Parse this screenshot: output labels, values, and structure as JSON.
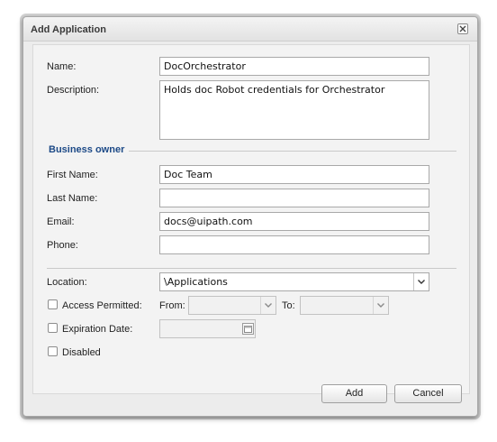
{
  "dialog": {
    "title": "Add Application",
    "close_icon": "close-icon"
  },
  "form": {
    "name": {
      "label": "Name:",
      "value": "DocOrchestrator"
    },
    "description": {
      "label": "Description:",
      "value": "Holds doc Robot credentials for Orchestrator"
    },
    "business_owner": {
      "section_title": "Business owner",
      "first_name": {
        "label": "First Name:",
        "value": "Doc Team"
      },
      "last_name": {
        "label": "Last Name:",
        "value": ""
      },
      "email": {
        "label": "Email:",
        "value": "docs@uipath.com"
      },
      "phone": {
        "label": "Phone:",
        "value": ""
      }
    },
    "location": {
      "label": "Location:",
      "value": "\\Applications"
    },
    "access_permitted": {
      "label": "Access Permitted:",
      "checked": false,
      "from_label": "From:",
      "to_label": "To:",
      "from_value": "",
      "to_value": ""
    },
    "expiration_date": {
      "label": "Expiration Date:",
      "checked": false,
      "value": ""
    },
    "disabled": {
      "label": "Disabled",
      "checked": false
    }
  },
  "buttons": {
    "add": "Add",
    "cancel": "Cancel"
  }
}
